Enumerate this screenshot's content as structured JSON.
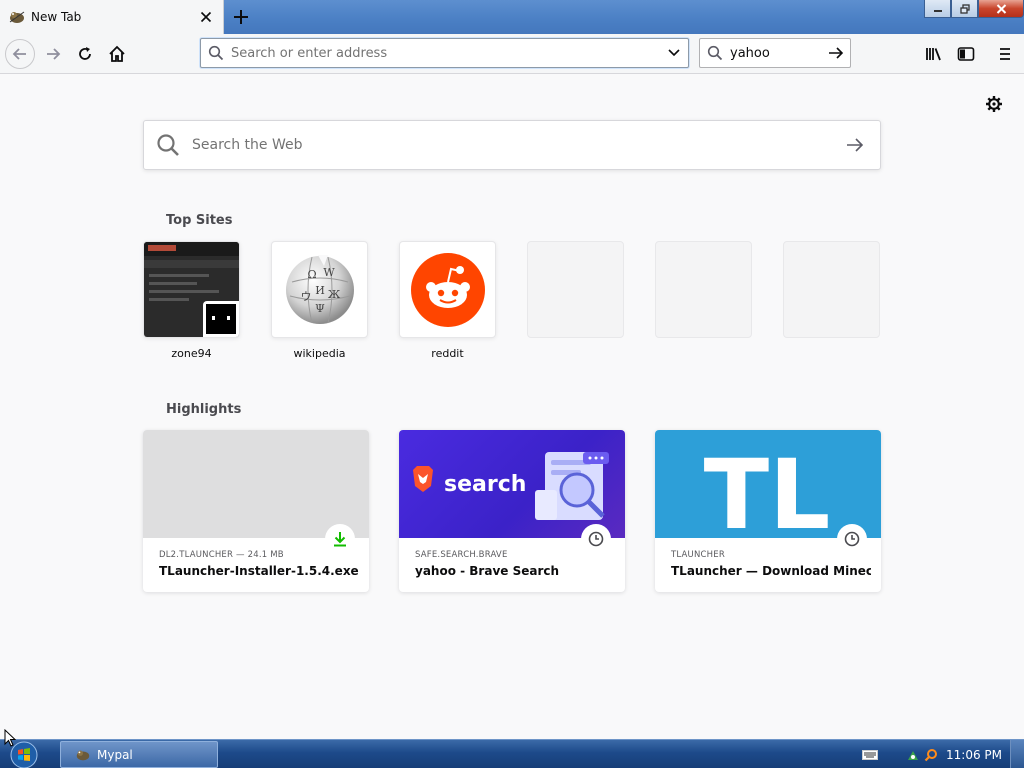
{
  "tab": {
    "title": "New Tab",
    "favicon": "mypal-icon"
  },
  "toolbar": {
    "url_placeholder": "Search or enter address",
    "url_value": "",
    "search_value": "yahoo"
  },
  "newtab": {
    "web_search_placeholder": "Search the Web",
    "top_sites_title": "Top Sites",
    "top_sites": [
      {
        "label": "zone94"
      },
      {
        "label": "wikipedia"
      },
      {
        "label": "reddit"
      },
      {
        "label": ""
      },
      {
        "label": ""
      },
      {
        "label": ""
      }
    ],
    "highlights_title": "Highlights",
    "highlights": [
      {
        "source": "DL2.TLAUNCHER — 24.1 MB",
        "title": "TLauncher-Installer-1.5.4.exe",
        "badge": "download-icon"
      },
      {
        "source": "SAFE.SEARCH.BRAVE",
        "title": "yahoo - Brave Search",
        "badge": "clock-icon",
        "thumb_text": "search"
      },
      {
        "source": "TLAUNCHER",
        "title": "TLauncher — Download Minecraft",
        "badge": "clock-icon",
        "thumb_text": "TL"
      }
    ]
  },
  "taskbar": {
    "task_label": "Mypal",
    "clock": "11:06 PM"
  },
  "colors": {
    "reddit": "#ff4500",
    "brave": "#3b2bd1",
    "tlauncher": "#2d9fd8",
    "download": "#12bc00"
  }
}
